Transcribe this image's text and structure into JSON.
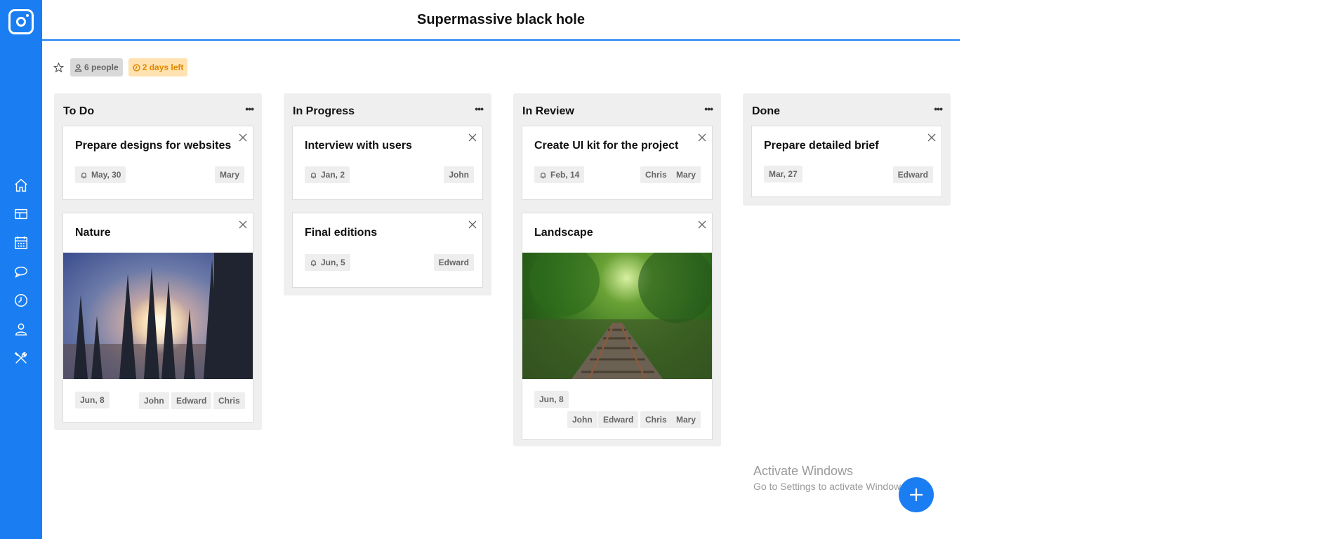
{
  "app": {
    "colors": {
      "accent": "#1a7ef2",
      "column_bg": "#efefef",
      "warning": "#e08800"
    }
  },
  "sidebar": {
    "items": [
      {
        "icon": "home-icon"
      },
      {
        "icon": "table-icon"
      },
      {
        "icon": "calendar-icon"
      },
      {
        "icon": "chat-icon"
      },
      {
        "icon": "clock-icon"
      },
      {
        "icon": "user-icon"
      },
      {
        "icon": "tools-icon"
      }
    ]
  },
  "header": {
    "title": "Supermassive black hole"
  },
  "board_meta": {
    "people": "6 people",
    "deadline": "2 days left"
  },
  "columns": [
    {
      "title": "To Do",
      "cards": [
        {
          "title": "Prepare designs for websites",
          "date": "May, 30",
          "assignees": [
            "Mary"
          ]
        },
        {
          "title": "Nature",
          "image": "forest-sunrise-photo",
          "date": "Jun, 8",
          "assignees": [
            "John",
            "Edward",
            "Chris"
          ]
        }
      ]
    },
    {
      "title": "In Progress",
      "cards": [
        {
          "title": "Interview with users",
          "date": "Jan, 2",
          "assignees": [
            "John"
          ]
        },
        {
          "title": "Final editions",
          "date": "Jun, 5",
          "assignees": [
            "Edward"
          ]
        }
      ]
    },
    {
      "title": "In Review",
      "cards": [
        {
          "title": "Create UI kit for the project",
          "date": "Feb, 14",
          "assignees": [
            "Chris",
            "Mary"
          ]
        },
        {
          "title": "Landscape",
          "image": "railway-in-forest-photo",
          "date": "Jun, 8",
          "assignees": [
            "John",
            "Edward",
            "Chris",
            "Mary"
          ]
        }
      ]
    },
    {
      "title": "Done",
      "cards": [
        {
          "title": "Prepare detailed brief",
          "date": "Mar, 27",
          "assignees": [
            "Edward"
          ]
        }
      ]
    }
  ],
  "watermark": {
    "title": "Activate Windows",
    "subtitle": "Go to Settings to activate Windows."
  }
}
